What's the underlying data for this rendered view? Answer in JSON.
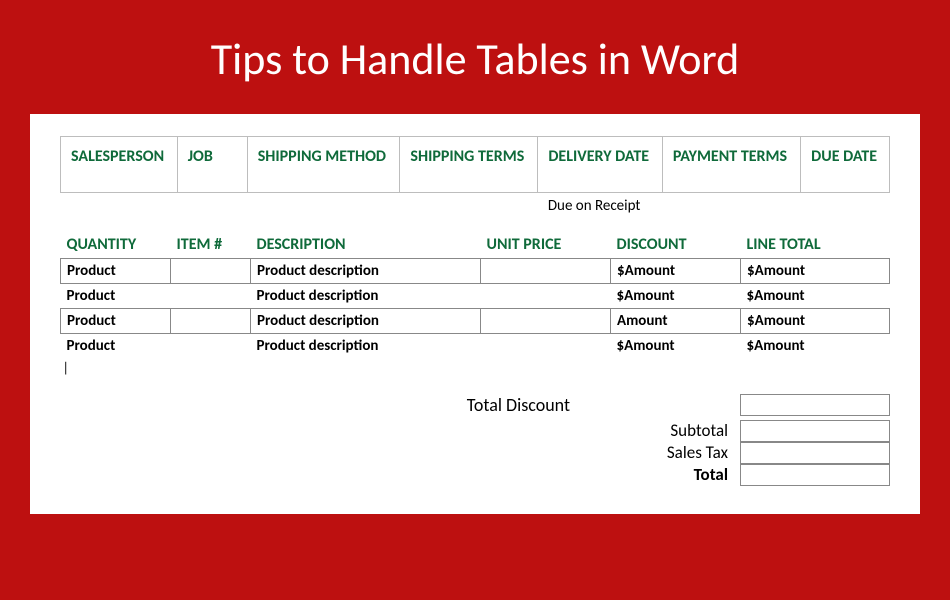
{
  "title": "Tips to Handle Tables in Word",
  "headerTable": {
    "headers": [
      "SALESPERSON",
      "JOB",
      "SHIPPING METHOD",
      "SHIPPING TERMS",
      "DELIVERY DATE",
      "PAYMENT TERMS",
      "DUE DATE"
    ],
    "deliveryDate": "Due on Receipt"
  },
  "itemsTable": {
    "headers": [
      "QUANTITY",
      "ITEM #",
      "DESCRIPTION",
      "UNIT PRICE",
      "DISCOUNT",
      "LINE TOTAL"
    ],
    "rows": [
      {
        "qty": "Product",
        "item": "",
        "desc": "Product description",
        "unit": "",
        "discount": "$Amount",
        "total": "$Amount",
        "bordered": true
      },
      {
        "qty": "Product",
        "item": "",
        "desc": "Product description",
        "unit": "",
        "discount": "$Amount",
        "total": "$Amount",
        "bordered": false
      },
      {
        "qty": "Product",
        "item": "",
        "desc": "Product description",
        "unit": "",
        "discount": "Amount",
        "total": "$Amount",
        "bordered": true
      },
      {
        "qty": "Product",
        "item": "",
        "desc": "Product description",
        "unit": "",
        "discount": "$Amount",
        "total": "$Amount",
        "bordered": false
      }
    ],
    "cursor": "|"
  },
  "totals": {
    "totalDiscount": "Total Discount",
    "subtotal": "Subtotal",
    "salesTax": "Sales Tax",
    "total": "Total"
  }
}
